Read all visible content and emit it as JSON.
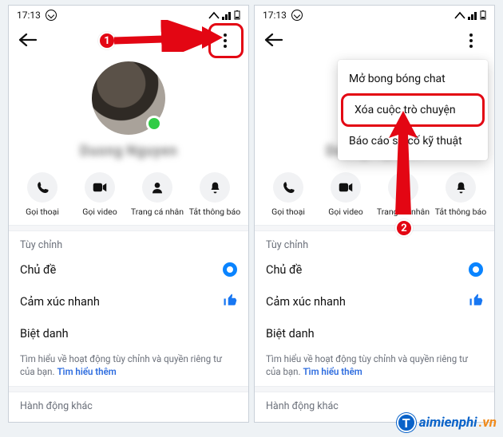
{
  "status": {
    "time": "17:13"
  },
  "profile": {
    "name": "Duong Nguyen"
  },
  "actions": {
    "call_label": "Gọi thoại",
    "video_label": "Gọi video",
    "profile_label": "Trang cá nhân",
    "mute_label": "Tắt thông báo"
  },
  "sections": {
    "customize": "Tùy chỉnh",
    "theme": "Chủ đề",
    "quick_reaction": "Cảm xúc nhanh",
    "nickname": "Biệt danh",
    "other_actions": "Hành động khác"
  },
  "policy": {
    "text": "Tìm hiểu về hoạt động tùy chỉnh và quyền riêng tư của bạn.",
    "link": "Tìm hiểu thêm"
  },
  "menu": {
    "open_bubble": "Mở bong bóng chat",
    "delete_conversation": "Xóa cuộc trò chuyện",
    "report_issue": "Báo cáo sự cố kỹ thuật"
  },
  "annotations": {
    "step1": "1",
    "step2": "2"
  },
  "watermark": {
    "brand": "aimienphi",
    "suffix": ".vn"
  }
}
